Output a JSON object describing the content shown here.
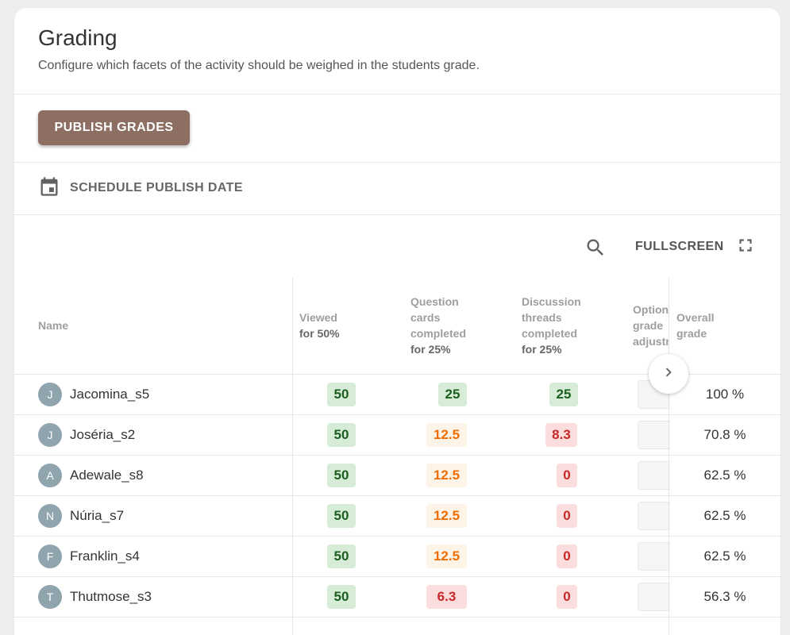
{
  "header": {
    "title": "Grading",
    "subtitle": "Configure which facets of the activity should be weighed in the students grade."
  },
  "actions": {
    "publish_label": "PUBLISH GRADES",
    "schedule_label": "SCHEDULE PUBLISH DATE",
    "schedule_icon": "calendar-icon"
  },
  "toolbar": {
    "search_icon": "search-icon",
    "fullscreen_label": "FULLSCREEN",
    "fullscreen_icon": "fullscreen-icon"
  },
  "table": {
    "columns": {
      "name": "Name",
      "viewed": {
        "label": "Viewed",
        "weight": "for 50%"
      },
      "cards": {
        "label_1": "Question",
        "label_2": "cards",
        "label_3": "completed",
        "weight": "for 25%"
      },
      "threads": {
        "label_1": "Discussion",
        "label_2": "threads",
        "label_3": "completed",
        "weight": "for 25%"
      },
      "adjust": {
        "label_1": "Optional",
        "label_2": "grade",
        "label_3": "adjustment"
      },
      "overall": {
        "label_1": "Overall",
        "label_2": "grade"
      }
    },
    "rows": [
      {
        "initial": "J",
        "name": "Jacomina_s5",
        "viewed": "50",
        "cards": "25",
        "threads": "25",
        "overall": "100 %"
      },
      {
        "initial": "J",
        "name": "Joséria_s2",
        "viewed": "50",
        "cards": "12.5",
        "threads": "8.3",
        "overall": "70.8 %"
      },
      {
        "initial": "A",
        "name": "Adewale_s8",
        "viewed": "50",
        "cards": "12.5",
        "threads": "0",
        "overall": "62.5 %"
      },
      {
        "initial": "N",
        "name": "Núria_s7",
        "viewed": "50",
        "cards": "12.5",
        "threads": "0",
        "overall": "62.5 %"
      },
      {
        "initial": "F",
        "name": "Franklin_s4",
        "viewed": "50",
        "cards": "12.5",
        "threads": "0",
        "overall": "62.5 %"
      },
      {
        "initial": "T",
        "name": "Thutmose_s3",
        "viewed": "50",
        "cards": "6.3",
        "threads": "0",
        "overall": "56.3 %"
      }
    ]
  },
  "colors": {
    "primary_button": "#8d6e63",
    "good": "#1b5e20",
    "partial": "#ef6c00",
    "bad": "#c62828"
  }
}
